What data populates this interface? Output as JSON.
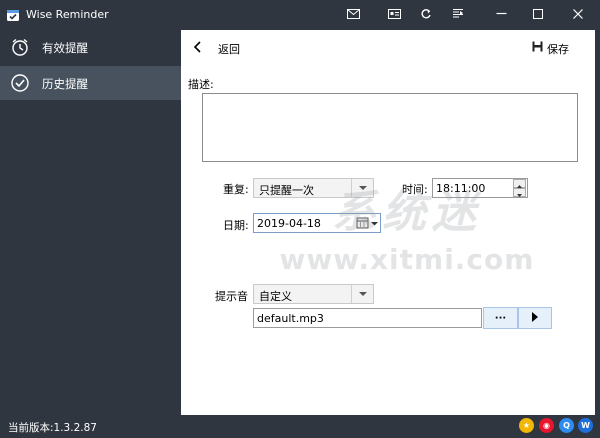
{
  "app": {
    "title": "Wise Reminder"
  },
  "sidebar": {
    "items": [
      {
        "label": "有效提醒",
        "icon": "alarm-clock-icon",
        "active": false
      },
      {
        "label": "历史提醒",
        "icon": "check-circle-icon",
        "active": true
      }
    ]
  },
  "header": {
    "back_label": "返回",
    "save_label": "保存"
  },
  "form": {
    "description_label": "描述:",
    "description_value": "",
    "repeat_label": "重复:",
    "repeat_value": "只提醒一次",
    "time_label": "时间:",
    "time_value": "18:11:00",
    "date_label": "日期:",
    "date_value": "2019-04-18",
    "sound_label": "提示音",
    "sound_value": "自定义",
    "sound_file": "default.mp3",
    "browse_label": "···"
  },
  "status": {
    "version": "当前版本:1.3.2.87"
  },
  "social": [
    {
      "name": "qq-zone",
      "color": "#f2b705"
    },
    {
      "name": "weibo",
      "color": "#e6162d"
    },
    {
      "name": "qq",
      "color": "#2d8cf0"
    },
    {
      "name": "wechat",
      "color": "#1e6fd9"
    }
  ],
  "watermark": {
    "cn": "系统迷",
    "url": "www.xitmi.com"
  },
  "colors": {
    "chrome": "#2f3640",
    "sidebar_active": "#47525e",
    "main_bg": "#ffffff"
  }
}
